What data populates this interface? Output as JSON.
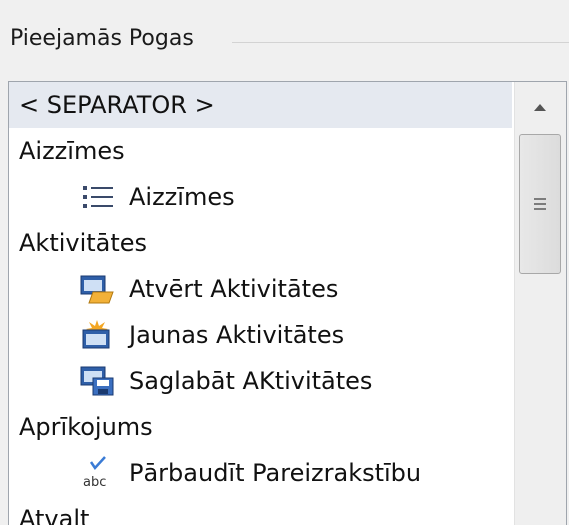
{
  "group": {
    "title": "Pieejamās Pogas"
  },
  "list": {
    "rows": [
      {
        "type": "category",
        "label": "< SEPARATOR >",
        "selected": true
      },
      {
        "type": "category",
        "label": "Aizzīmes"
      },
      {
        "type": "item",
        "label": "Aizzīmes",
        "icon": "bullet-list-icon"
      },
      {
        "type": "category",
        "label": "Aktivitātes"
      },
      {
        "type": "item",
        "label": "Atvērt Aktivitātes",
        "icon": "open-activities-icon"
      },
      {
        "type": "item",
        "label": "Jaunas Aktivitātes",
        "icon": "new-activities-icon"
      },
      {
        "type": "item",
        "label": "Saglabāt AKtivitātes",
        "icon": "save-activities-icon"
      },
      {
        "type": "category",
        "label": "Aprīkojums"
      },
      {
        "type": "item",
        "label": "Pārbaudīt Pareizrakstību",
        "icon": "spellcheck-icon"
      },
      {
        "type": "category",
        "label": "Atvalt"
      }
    ]
  },
  "scrollbar": {
    "up_icon": "scroll-up-arrow-icon",
    "grip_icon": "scroll-grip-icon"
  },
  "colors": {
    "background": "#f0f0f0",
    "list_background": "#ffffff",
    "selected_row": "#e5e9f0",
    "border": "#9fa5ad"
  }
}
